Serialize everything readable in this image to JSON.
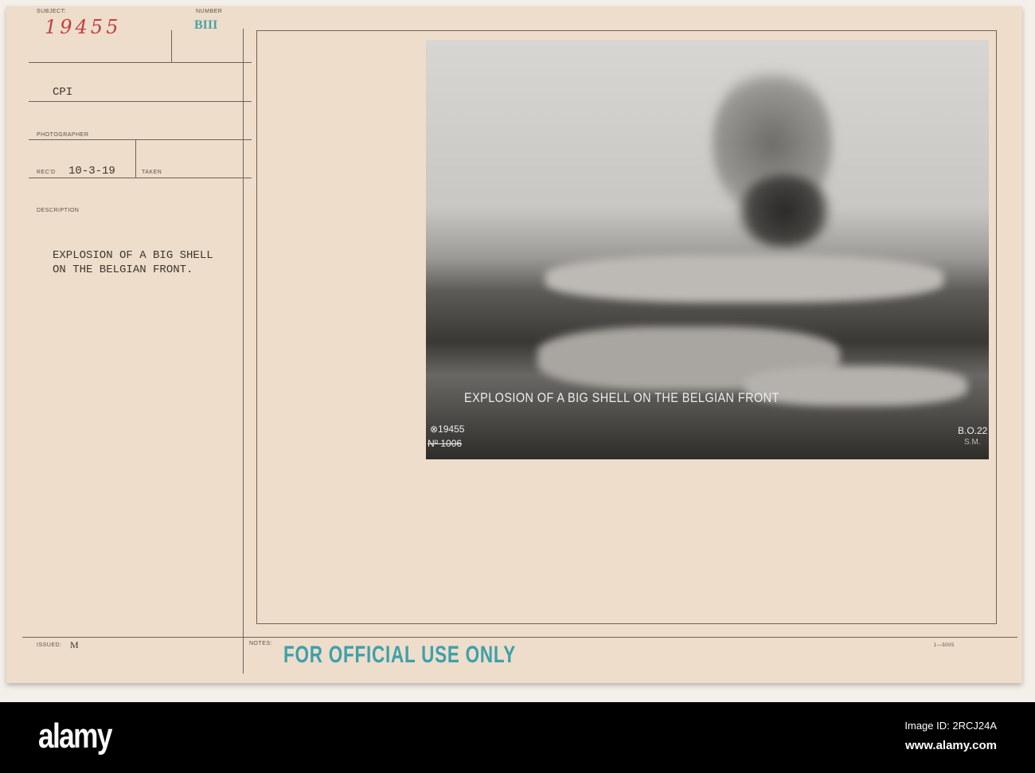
{
  "card": {
    "subject_label": "SUBJECT:",
    "subject_value": "19455",
    "number_label": "NUMBER",
    "number_value": "BIII",
    "agency": "CPI",
    "photographer_label": "PHOTOGRAPHER",
    "recd_label": "REC'D",
    "recd_value": "10-3-19",
    "taken_label": "TAKEN",
    "description_label": "DESCRIPTION",
    "description_line1": "EXPLOSION OF A BIG SHELL",
    "description_line2": "ON THE BELGIAN FRONT.",
    "issued_label": "ISSUED:",
    "issued_value": "M",
    "notes_label": "NOTES:",
    "stamp": "FOR OFFICIAL USE ONLY",
    "form_number": "1—5005"
  },
  "photo": {
    "caption": "EXPLOSION OF A BIG SHELL ON THE BELGIAN FRONT",
    "ref_number": "⊗19455",
    "struck_number": "Nº 1006",
    "corner_code": "B.O.22",
    "corner_initials": "S.M."
  },
  "footer": {
    "logo": "alamy",
    "image_id": "Image ID: 2RCJ24A",
    "url": "www.alamy.com"
  }
}
